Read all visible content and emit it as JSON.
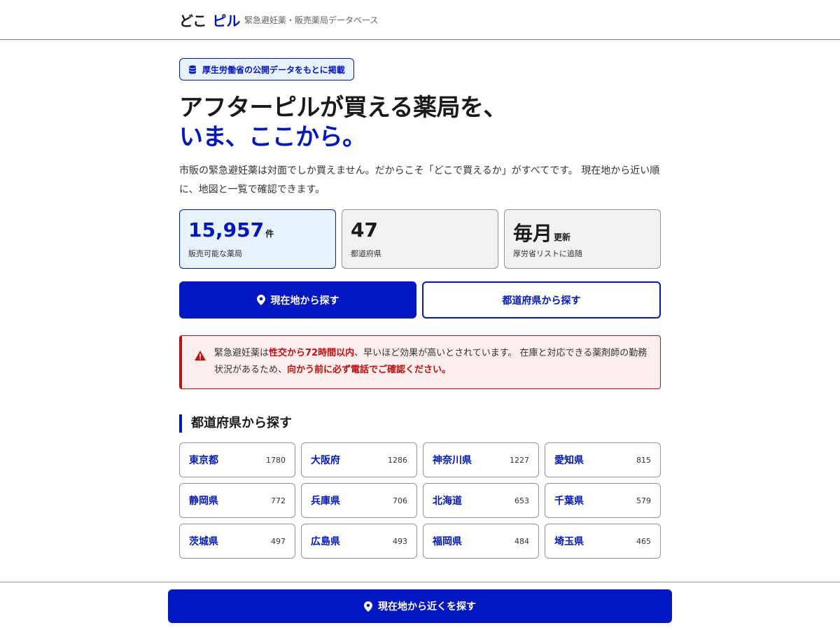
{
  "header": {
    "logo_word": "どこ",
    "logo_accent": "ピル",
    "tagline": "緊急避妊薬・販売薬局データベース"
  },
  "hero": {
    "badge": "厚生労働省の公開データをもとに掲載",
    "title_line1": "アフターピルが買える薬局を、",
    "title_line2": "いま、ここから。",
    "lead": "市販の緊急避妊薬は対面でしか買えません。だからこそ「どこで買えるか」がすべてです。 現在地から近い順に、地図と一覧で確認できます。"
  },
  "stats": [
    {
      "value": "15,957",
      "unit": "件",
      "label": "販売可能な薬局"
    },
    {
      "value": "47",
      "unit": "",
      "label": "都道府県"
    },
    {
      "value": "毎月",
      "unit": "更新",
      "label": "厚労省リストに追随"
    }
  ],
  "actions": {
    "locate_label": "現在地から探す",
    "prefecture_label": "都道府県から探す"
  },
  "alert": {
    "part1": "緊急避妊薬は",
    "em1": "性交から72時間以内",
    "part2": "、早いほど効果が高いとされています。 在庫と対応できる薬剤師の勤務状況があるため、",
    "em2": "向かう前に必ず電話でご確認ください。"
  },
  "prefectures": {
    "heading": "都道府県から探す",
    "items": [
      {
        "name": "東京都",
        "count": "1780"
      },
      {
        "name": "大阪府",
        "count": "1286"
      },
      {
        "name": "神奈川県",
        "count": "1227"
      },
      {
        "name": "愛知県",
        "count": "815"
      },
      {
        "name": "静岡県",
        "count": "772"
      },
      {
        "name": "兵庫県",
        "count": "706"
      },
      {
        "name": "北海道",
        "count": "653"
      },
      {
        "name": "千葉県",
        "count": "579"
      },
      {
        "name": "茨城県",
        "count": "497"
      },
      {
        "name": "広島県",
        "count": "493"
      },
      {
        "name": "福岡県",
        "count": "484"
      },
      {
        "name": "埼玉県",
        "count": "465"
      }
    ]
  },
  "sticky": {
    "label": "現在地から近くを探す"
  },
  "colors": {
    "brand": "#0017c1",
    "danger": "#c40d0d",
    "badge_bg": "#e8f1fe",
    "alert_bg": "#fdeeee"
  },
  "icons": {
    "badge": "database-icon",
    "locate": "map-pin-icon",
    "alert": "warning-triangle-icon"
  }
}
